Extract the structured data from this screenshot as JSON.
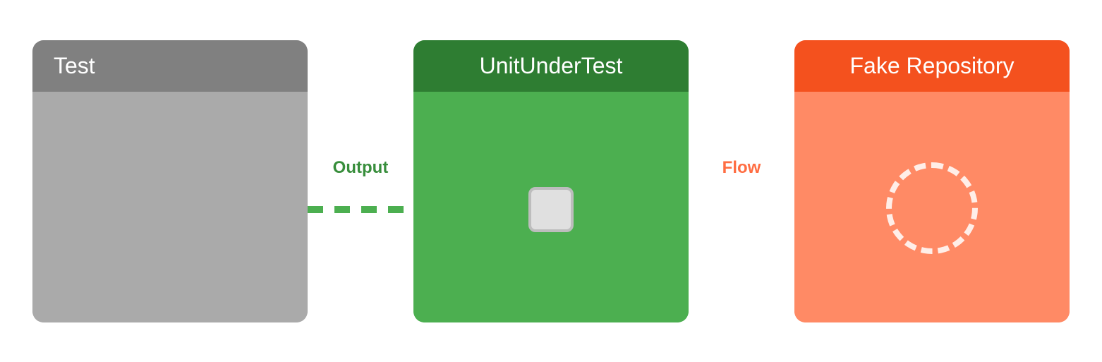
{
  "boxes": {
    "test": {
      "header": "Test",
      "header_bg": "#6e6e6e",
      "body_bg": "#adadad"
    },
    "uut": {
      "header": "UnitUnderTest",
      "header_bg": "#2d6e2d",
      "body_bg": "#4caf50"
    },
    "fake": {
      "header": "Fake Repository",
      "header_bg": "#e84e1b",
      "body_bg": "#f47c55"
    }
  },
  "labels": {
    "output": "Output",
    "flow": "Flow"
  },
  "colors": {
    "green_dash": "#4caf50",
    "orange_dash": "rgba(255,255,255,0.85)",
    "port_fill": "#d8d8d8",
    "port_border": "#c0c0c0"
  }
}
